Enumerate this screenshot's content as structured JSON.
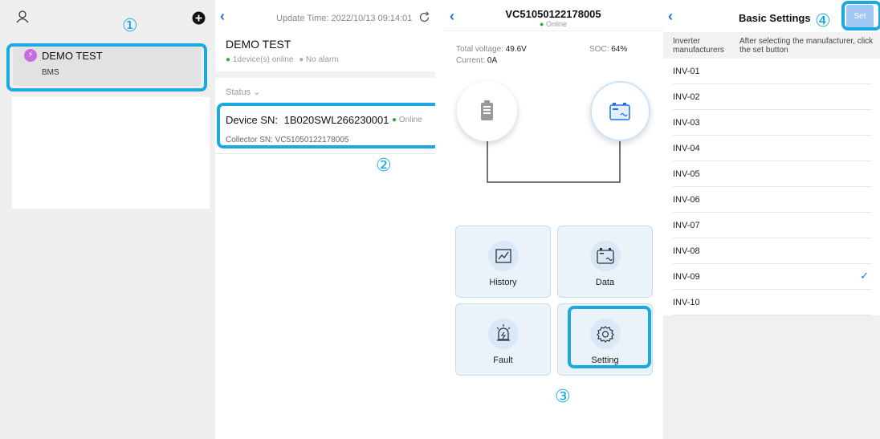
{
  "panel1": {
    "plant_name": "DEMO TEST",
    "plant_type": "BMS",
    "step_label": "①"
  },
  "panel2": {
    "update_time": "Update Time:  2022/10/13 09:14:01",
    "plant_name": "DEMO TEST",
    "online_status": "1device(s) online",
    "alarm_status": "No alarm",
    "status_filter": "Status",
    "device_sn_label": "Device SN:",
    "device_sn": "1B020SWL266230001",
    "device_status": "Online",
    "collector_sn": "Collector SN:  VC51050122178005",
    "step_label": "②"
  },
  "panel3": {
    "title": "VC51050122178005",
    "status": "Online",
    "total_voltage_label": "Total voltage:",
    "total_voltage": "49.6V",
    "soc_label": "SOC:",
    "soc": "64%",
    "current_label": "Current:",
    "current": "0A",
    "tiles": {
      "history": "History",
      "data": "Data",
      "fault": "Fault",
      "setting": "Setting"
    },
    "step_label": "③"
  },
  "panel4": {
    "title": "Basic Settings",
    "set_button": "Set",
    "header_left": "Inverter manufacturers",
    "header_right": "After selecting the manufacturer, click the set button",
    "items": [
      "INV-01",
      "INV-02",
      "INV-03",
      "INV-04",
      "INV-05",
      "INV-06",
      "INV-07",
      "INV-08",
      "INV-09",
      "INV-10"
    ],
    "selected_index": 8,
    "step_label": "④"
  },
  "colors": {
    "highlight": "#1ba9e3",
    "accent": "#1a73e8",
    "online": "#2eaa3c"
  }
}
